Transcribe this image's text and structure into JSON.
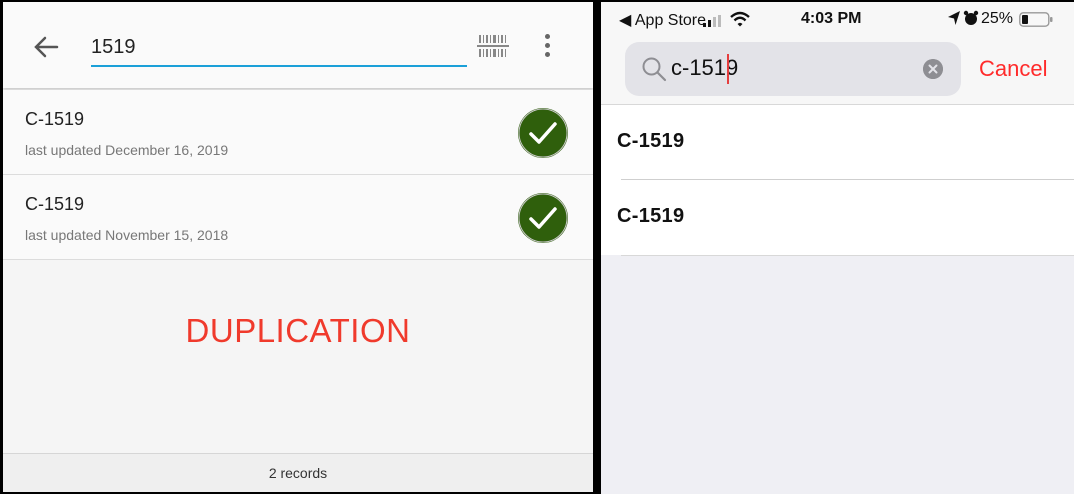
{
  "left": {
    "search_value": "1519",
    "results": [
      {
        "title": "C-1519",
        "subtitle": "last updated December 16, 2019"
      },
      {
        "title": "C-1519",
        "subtitle": "last updated November 15, 2018"
      }
    ],
    "overlay_label": "DUPLICATION",
    "footer_count": "2 records",
    "colors": {
      "accent": "#1ba0d8",
      "check": "#2f5f0c",
      "overlay": "#f03a2c"
    }
  },
  "right": {
    "status": {
      "back_app": "◀ App Store",
      "time": "4:03 PM",
      "battery": "25%"
    },
    "search_value": "c-1519",
    "cancel_label": "Cancel",
    "results": [
      {
        "title": "C-1519"
      },
      {
        "title": "C-1519"
      }
    ],
    "colors": {
      "cancel": "#ff2b2b",
      "caret": "#e53e3e"
    }
  }
}
